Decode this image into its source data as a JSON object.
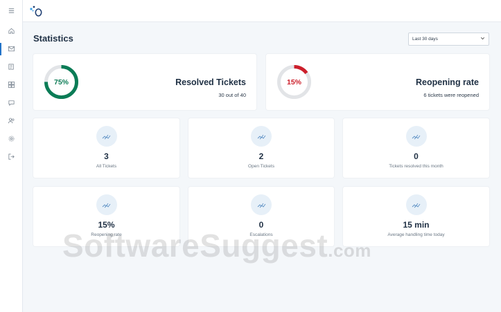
{
  "sidebar": {
    "items": [
      {
        "name": "menu-icon"
      },
      {
        "name": "home-icon"
      },
      {
        "name": "inbox-icon",
        "active": true
      },
      {
        "name": "document-icon"
      },
      {
        "name": "dashboard-grid-icon"
      },
      {
        "name": "chat-icon"
      },
      {
        "name": "users-icon"
      },
      {
        "name": "settings-icon"
      },
      {
        "name": "logout-icon"
      }
    ]
  },
  "header": {
    "title": "Statistics"
  },
  "period": {
    "selected": "Last 30 days"
  },
  "colors": {
    "green": "#0b7c56",
    "red": "#cc1f2b",
    "ring_track": "#e2e4e7",
    "accent": "#2273c8"
  },
  "resolved": {
    "percent_label": "75%",
    "percent": 75,
    "title": "Resolved Tickets",
    "subtitle": "30 out of 40"
  },
  "reopening": {
    "percent_label": "15%",
    "percent": 15,
    "title": "Reopening rate",
    "subtitle": "6 tickets were reopened"
  },
  "stats": [
    {
      "value": "3",
      "label": "All Tickets",
      "icon": "trend-icon"
    },
    {
      "value": "2",
      "label": "Open Tickets",
      "icon": "trend-icon"
    },
    {
      "value": "0",
      "label": "Tickets resolved this month",
      "icon": "trend-icon"
    },
    {
      "value": "15%",
      "label": "Reopening rate",
      "icon": "trend-icon"
    },
    {
      "value": "0",
      "label": "Escalations",
      "icon": "trend-icon"
    },
    {
      "value": "15 min",
      "label": "Average handling time today",
      "icon": "trend-icon"
    }
  ],
  "watermark": {
    "text": "SoftwareSuggest",
    "suffix": ".com"
  }
}
